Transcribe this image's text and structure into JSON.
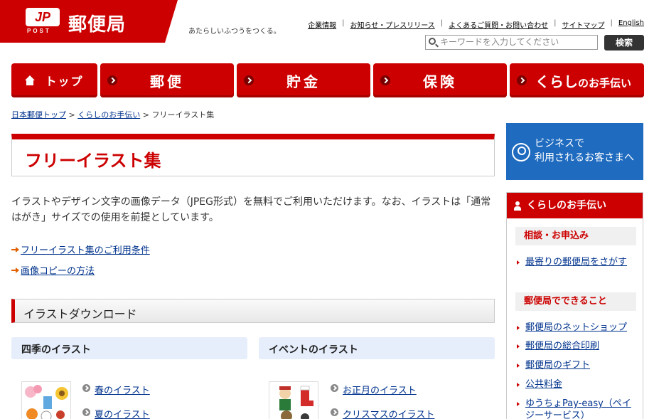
{
  "header": {
    "logo_mark": "JP",
    "logo_post": "POST",
    "logo_name": "郵便局",
    "tagline": "あたらしいふつうをつくる。",
    "utility_links": [
      "企業情報",
      "お知らせ・プレスリリース",
      "よくあるご質問・お問い合わせ",
      "サイトマップ",
      "English"
    ],
    "search_placeholder": "キーワードを入力してください",
    "search_button": "検索"
  },
  "nav": {
    "home": "トップ",
    "mail": "郵便",
    "savings": "貯金",
    "insurance": "保険",
    "life_main": "くらし",
    "life_small": "のお手伝い"
  },
  "breadcrumb": {
    "item1": "日本郵便トップ",
    "item2": "くらしのお手伝い",
    "current": "フリーイラスト集",
    "separator": ">"
  },
  "main": {
    "title": "フリーイラスト集",
    "intro": "イラストやデザイン文字の画像データ（JPEG形式）を無料でご利用いただけます。なお、イラストは「通常はがき」サイズでの使用を前提としています。",
    "links": [
      "フリーイラスト集のご利用条件",
      "画像コピーの方法"
    ],
    "section_title": "イラストダウンロード",
    "categories": [
      {
        "title": "四季のイラスト",
        "items": [
          "春のイラスト",
          "夏のイラスト"
        ]
      },
      {
        "title": "イベントのイラスト",
        "items": [
          "お正月のイラスト",
          "クリスマスのイラスト"
        ]
      }
    ]
  },
  "sidebar": {
    "business_line1": "ビジネスで",
    "business_line2": "利用されるお客さまへ",
    "panel_title": "くらしのお手伝い",
    "sub1": "相談・お申込み",
    "sub1_links": [
      "最寄りの郵便局をさがす"
    ],
    "sub2": "郵便局でできること",
    "sub2_links": [
      "郵便局のネットショップ",
      "郵便局の総合印刷",
      "郵便局のギフト",
      "公共料金",
      "ゆうちょPay-easy（ペイジーサービス）"
    ]
  },
  "colors": {
    "brand_red": "#cc0000",
    "link_blue": "#00338d",
    "business_blue": "#1f6bbf"
  }
}
